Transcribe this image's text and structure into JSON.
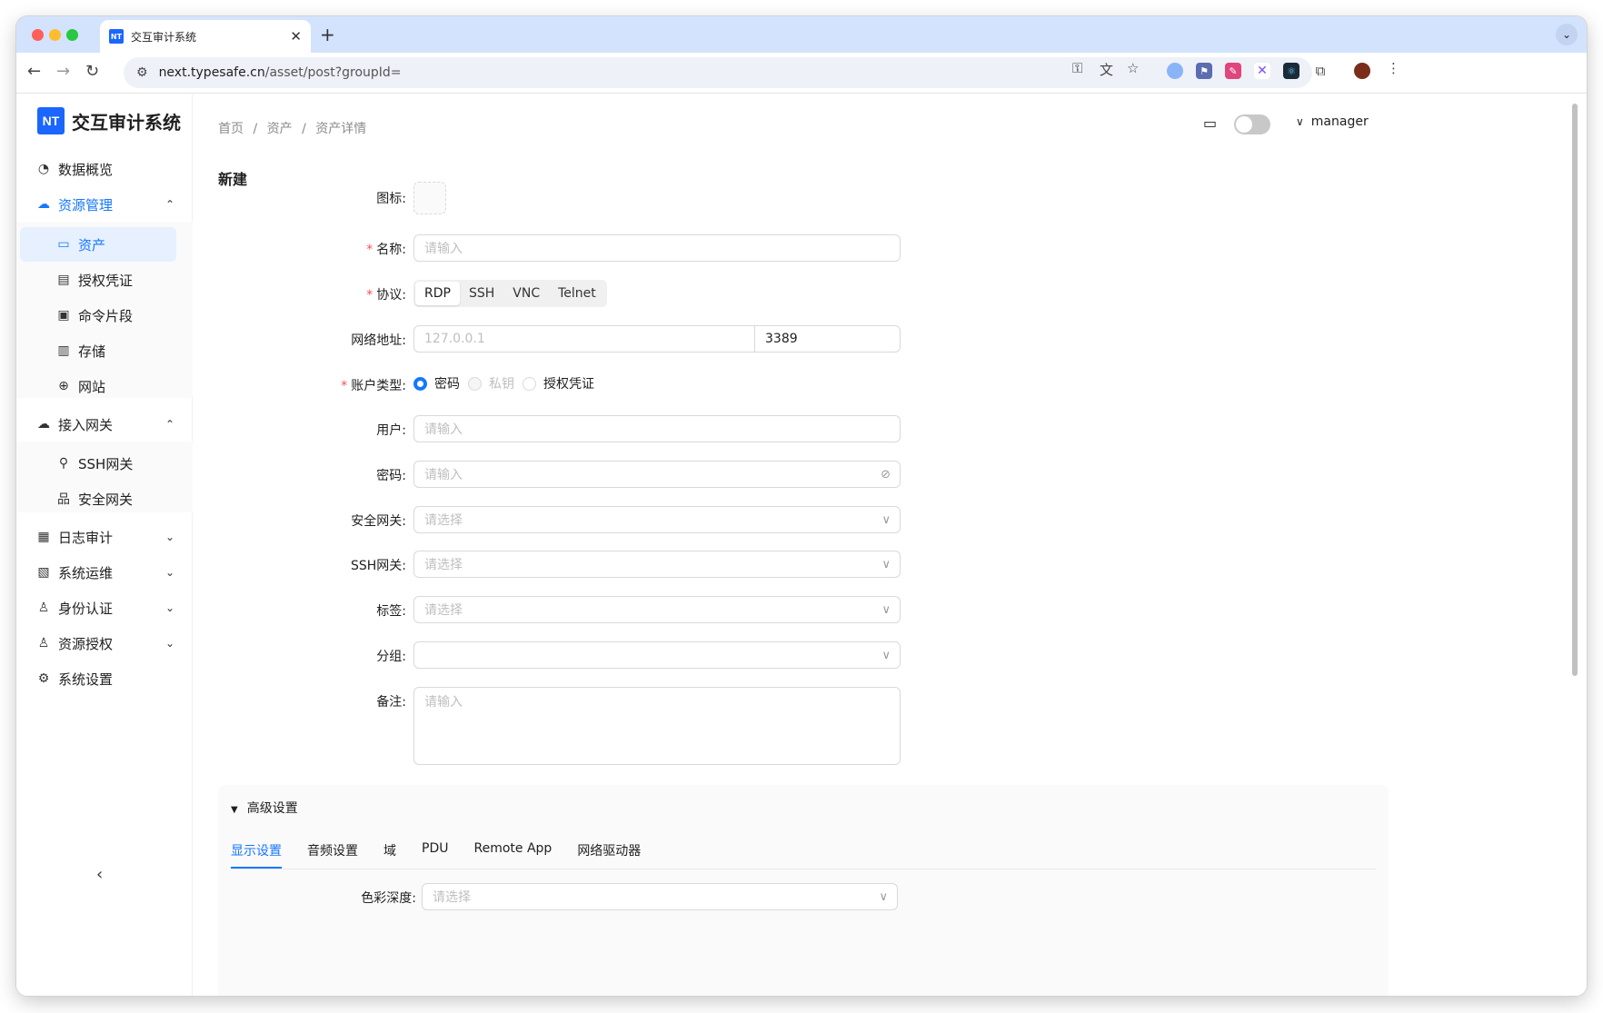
{
  "browser": {
    "tab_title": "交互审计系统",
    "tab_favicon": "NT",
    "url_host": "next.typesafe.cn",
    "url_path": "/asset/post?groupId="
  },
  "app": {
    "logo_mark": "NT",
    "logo_name": "交互审计系统"
  },
  "sidebar": {
    "items": [
      {
        "label": "数据概览",
        "icon": "dashboard-icon"
      },
      {
        "label": "资源管理",
        "icon": "cloud-icon"
      },
      {
        "label": "资产",
        "icon": "desktop-icon"
      },
      {
        "label": "授权凭证",
        "icon": "id-card-icon"
      },
      {
        "label": "命令片段",
        "icon": "terminal-icon"
      },
      {
        "label": "存储",
        "icon": "storage-icon"
      },
      {
        "label": "网站",
        "icon": "globe-icon"
      },
      {
        "label": "接入网关",
        "icon": "gateway-icon"
      },
      {
        "label": "SSH网关",
        "icon": "link-icon"
      },
      {
        "label": "安全网关",
        "icon": "cluster-icon"
      },
      {
        "label": "日志审计",
        "icon": "audit-icon"
      },
      {
        "label": "系统运维",
        "icon": "ops-icon"
      },
      {
        "label": "身份认证",
        "icon": "user-icon"
      },
      {
        "label": "资源授权",
        "icon": "user-key-icon"
      },
      {
        "label": "系统设置",
        "icon": "gear-icon"
      }
    ]
  },
  "header": {
    "breadcrumb": [
      "首页",
      "/",
      "资产",
      "/",
      "资产详情"
    ],
    "user": "manager"
  },
  "form": {
    "title": "新建",
    "icon_label": "图标",
    "name_label": "名称",
    "name_placeholder": "请输入",
    "protocol_label": "协议",
    "protocols": [
      "RDP",
      "SSH",
      "VNC",
      "Telnet"
    ],
    "address_label": "网络地址",
    "address_placeholder": "127.0.0.1",
    "port_value": "3389",
    "account_type_label": "账户类型",
    "account_types": [
      "密码",
      "私钥",
      "授权凭证"
    ],
    "user_label": "用户",
    "user_placeholder": "请输入",
    "password_label": "密码",
    "password_placeholder": "请输入",
    "security_gateway_label": "安全网关",
    "security_gateway_placeholder": "请选择",
    "ssh_gateway_label": "SSH网关",
    "ssh_gateway_placeholder": "请选择",
    "tags_label": "标签",
    "tags_placeholder": "请选择",
    "group_label": "分组",
    "remark_label": "备注",
    "remark_placeholder": "请输入"
  },
  "advanced": {
    "title": "高级设置",
    "tabs": [
      "显示设置",
      "音频设置",
      "域",
      "PDU",
      "Remote App",
      "网络驱动器"
    ],
    "color_depth_label": "色彩深度",
    "color_depth_placeholder": "请选择"
  },
  "colors": {
    "primary": "#1677ff",
    "logo": "#1a66ff",
    "required": "#ff4d4f"
  }
}
